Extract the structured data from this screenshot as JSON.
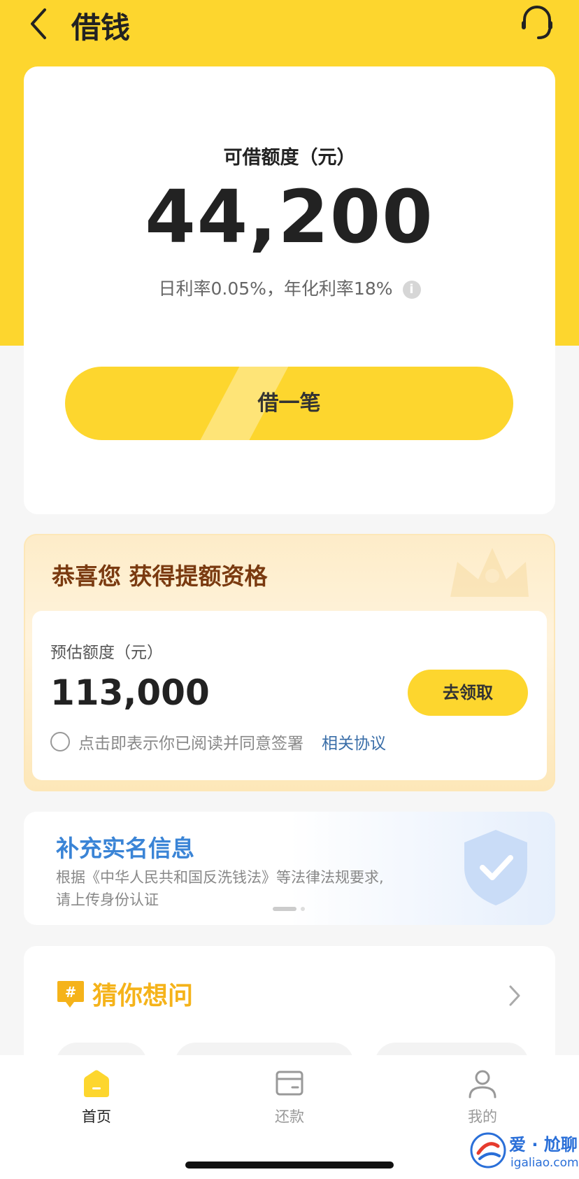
{
  "header": {
    "title": "借钱"
  },
  "main_card": {
    "limit_label": "可借额度（元）",
    "limit_amount": "44,200",
    "rate_text": "日利率0.05%，年化利率18%",
    "borrow_button": "借一笔"
  },
  "promo": {
    "title": "恭喜您 获得提额资格",
    "estimate_label": "预估额度（元）",
    "estimate_amount": "113,000",
    "claim_button": "去领取",
    "agree_text": "点击即表示你已阅读并同意签署",
    "agree_link": "相关协议"
  },
  "realname": {
    "title": "补充实名信息",
    "desc_line1": "根据《中华人民共和国反洗钱法》等法律法规要求,",
    "desc_line2": "请上传身份认证"
  },
  "guess": {
    "title": "猜你想问"
  },
  "tabbar": {
    "tabs": [
      {
        "label": "首页",
        "active": true,
        "icon": "home-icon"
      },
      {
        "label": "还款",
        "active": false,
        "icon": "wallet-icon"
      },
      {
        "label": "我的",
        "active": false,
        "icon": "person-icon"
      }
    ]
  },
  "watermark": {
    "name": "爱 · 尬聊",
    "domain": "igaliao.com"
  },
  "colors": {
    "brand_yellow": "#fdd62e",
    "promo_brown": "#7a3a10",
    "link_blue": "#3a84d6",
    "guess_orange": "#f5b31a"
  }
}
